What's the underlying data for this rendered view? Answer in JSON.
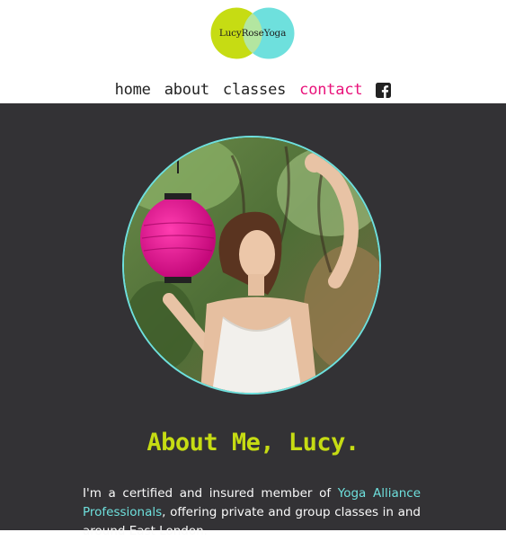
{
  "logo": {
    "text": "LucyRoseYoga",
    "left_color": "#c6dc13",
    "right_color": "#6ee0dd"
  },
  "nav": {
    "items": [
      {
        "label": "home",
        "active": false
      },
      {
        "label": "about",
        "active": false
      },
      {
        "label": "classes",
        "active": false
      },
      {
        "label": "contact",
        "active": true
      }
    ],
    "social_icon": "facebook-icon"
  },
  "hero": {
    "image_alt": "Lucy holding a pink paper lantern among green foliage"
  },
  "about": {
    "title": "About Me, Lucy.",
    "para_prefix": "I'm a certified and insured member of ",
    "link_text": "Yoga Alliance Professionals",
    "para_suffix": ", offering private and group classes in and around East London."
  },
  "colors": {
    "accent_lime": "#c6dc13",
    "accent_aqua": "#6ee0dd",
    "active_pink": "#e9137b",
    "background_dark": "#333235"
  }
}
